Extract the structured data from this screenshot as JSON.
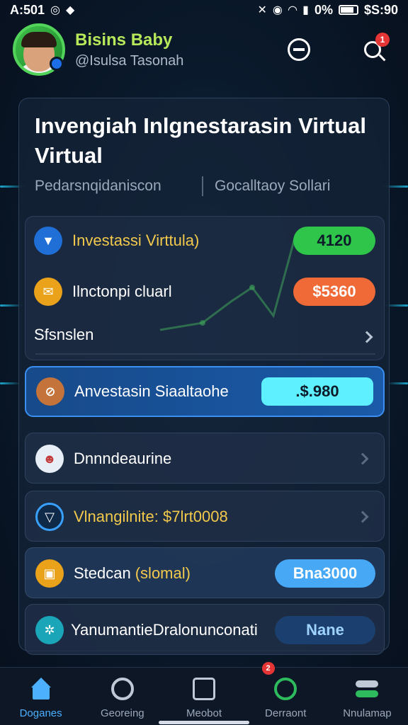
{
  "statusbar": {
    "time": "A:501",
    "right_text": "0%",
    "clock": "$S:90"
  },
  "header": {
    "user_name": "Bisins Baby",
    "user_handle": "@Isulsa Tasonah",
    "notification_count": "1"
  },
  "card": {
    "title": "Invengiah Inlgnestarasin Virtual Virtual",
    "meta_left": "Pedarsnqidaniscon",
    "meta_right": "Gocalltaoy Sollari"
  },
  "inner_rows": [
    {
      "label": "Investassi Virttula)",
      "value": "4120",
      "label_color": "#f2c94c",
      "pill_color": "#2fc44a",
      "icon": "shield-icon"
    },
    {
      "label": "Ilnctonpi cluarl",
      "value": "$5360",
      "label_color": "#ffffff",
      "pill_color": "#ef6a36",
      "icon": "envelope-icon"
    }
  ],
  "section_row": {
    "label": "Sfsnslen"
  },
  "list": [
    {
      "label": "Anvestasin Siaaltaohe",
      "value": ".$.980",
      "active": true,
      "icon": "crossed-coin-icon"
    },
    {
      "label": "Dnnndeaurine",
      "value": "",
      "icon": "person-icon"
    },
    {
      "label": "Vlnangilnite: $7lrt0008",
      "value": "",
      "icon": "shield-outline-icon",
      "label_color": "#f2c94c"
    },
    {
      "label": "Stedcan",
      "label_extra": "(slomal)",
      "value": "Bna3000",
      "icon": "square-coin-icon"
    },
    {
      "label": "YanumantieDralonunconati",
      "value": "Nane",
      "icon": "gear-icon"
    }
  ],
  "bottom_nav": [
    {
      "label": "Doganes",
      "active": true
    },
    {
      "label": "Georeing"
    },
    {
      "label": "Meobot"
    },
    {
      "label": "Derraont",
      "badge": "2"
    },
    {
      "label": "Nnulamap"
    }
  ],
  "colors": {
    "accent": "#4cb0ff",
    "green": "#2fc44a",
    "orange": "#ef6a36",
    "cyan": "#5ff0ff",
    "blue_pill": "#47a8f5"
  }
}
